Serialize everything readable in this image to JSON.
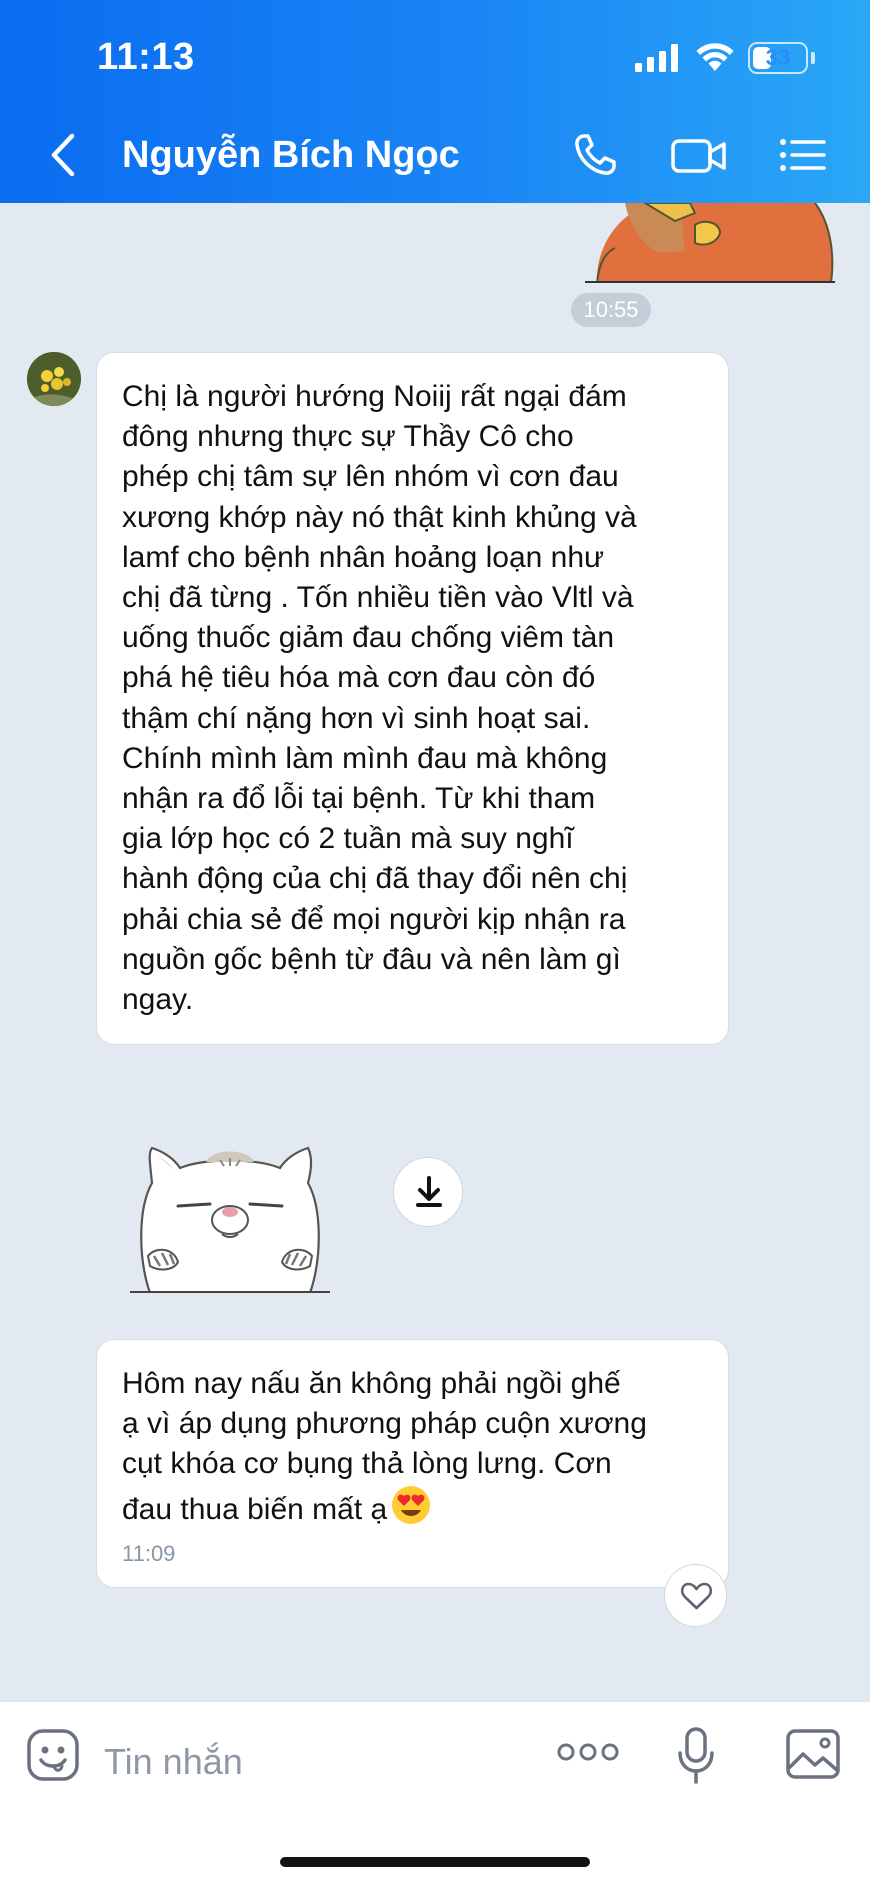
{
  "status_bar": {
    "time": "11:13",
    "battery": "33",
    "battery_level": 0.33
  },
  "header": {
    "contact_name": "Nguyễn Bích Ngọc",
    "icons": [
      "back-icon",
      "phone-icon",
      "video-call-icon",
      "menu-icon"
    ]
  },
  "chat": {
    "timestamp_top": "10:55",
    "message1": {
      "text": "Chị là người hướng Noiij rất ngại đám\nđông nhưng thực sự Thầy Cô cho\nphép chị tâm sự lên nhóm vì cơn đau\nxương khớp này nó thật kinh khủng và\nlamf cho bệnh nhân hoảng loạn như\nchị đã từng . Tốn nhiều tiền vào Vltl và\nuống thuốc giảm đau chống viêm tàn\nphá hệ tiêu hóa mà cơn đau còn đó\nthậm chí nặng hơn vì sinh hoạt sai.\nChính mình làm mình đau mà không\nnhận ra đổ lỗi tại bệnh. Từ khi tham\ngia lớp học có 2 tuần mà suy nghĩ\nhành động của chị đã thay đổi nên chị\nphải chia sẻ để mọi người kịp nhận ra\nnguồn gốc bệnh từ đâu và nên làm gì\nngay."
    },
    "message2": {
      "text": "Hôm nay nấu ăn không phải ngồi ghế\nạ vì áp dụng phương pháp cuộn xương\ncụt khóa cơ bụng thả lòng lưng. Cơn\nđau thua biến mất ạ",
      "time": "11:09"
    }
  },
  "composer": {
    "placeholder": "Tin nhắn"
  },
  "colors": {
    "header_start": "#0a6cf0",
    "header_end": "#2aa8f6",
    "chat_background": "#e2e9f1",
    "bubble": "#ffffff"
  }
}
